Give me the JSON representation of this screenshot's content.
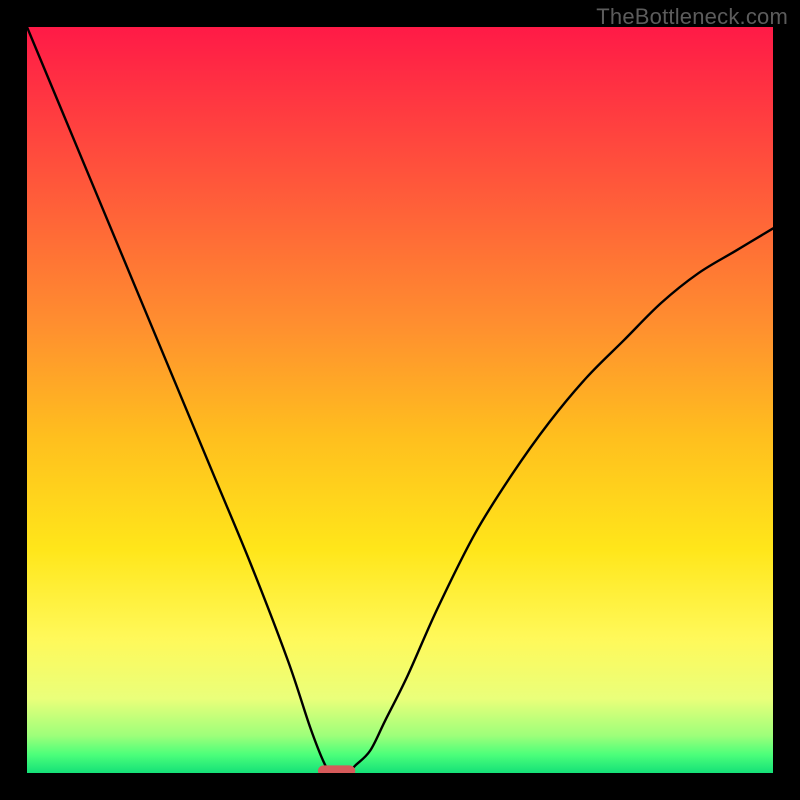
{
  "watermark": "TheBottleneck.com",
  "chart_data": {
    "type": "line",
    "title": "",
    "xlabel": "",
    "ylabel": "",
    "xlim": [
      0,
      100
    ],
    "ylim": [
      0,
      100
    ],
    "grid": false,
    "legend": false,
    "background_gradient": {
      "stops": [
        {
          "offset": 0,
          "color": "#ff1a47"
        },
        {
          "offset": 0.22,
          "color": "#ff5a3a"
        },
        {
          "offset": 0.4,
          "color": "#ff8f2f"
        },
        {
          "offset": 0.55,
          "color": "#ffbf1e"
        },
        {
          "offset": 0.7,
          "color": "#ffe61a"
        },
        {
          "offset": 0.82,
          "color": "#fff95a"
        },
        {
          "offset": 0.9,
          "color": "#eaff7a"
        },
        {
          "offset": 0.95,
          "color": "#9dff7a"
        },
        {
          "offset": 0.975,
          "color": "#4dff7a"
        },
        {
          "offset": 1.0,
          "color": "#14e178"
        }
      ]
    },
    "series": [
      {
        "name": "bottleneck-curve",
        "x": [
          0,
          5,
          10,
          15,
          20,
          25,
          30,
          35,
          38,
          40,
          41,
          42,
          43,
          44,
          46,
          48,
          51,
          55,
          60,
          65,
          70,
          75,
          80,
          85,
          90,
          95,
          100
        ],
        "y": [
          100,
          88,
          76,
          64,
          52,
          40,
          28,
          15,
          6,
          1,
          0,
          0,
          0,
          1,
          3,
          7,
          13,
          22,
          32,
          40,
          47,
          53,
          58,
          63,
          67,
          70,
          73
        ]
      }
    ],
    "marker": {
      "name": "optimal-marker",
      "x": 41.5,
      "y": 0,
      "width": 5,
      "height": 1.5,
      "color": "#d65a5a"
    }
  }
}
